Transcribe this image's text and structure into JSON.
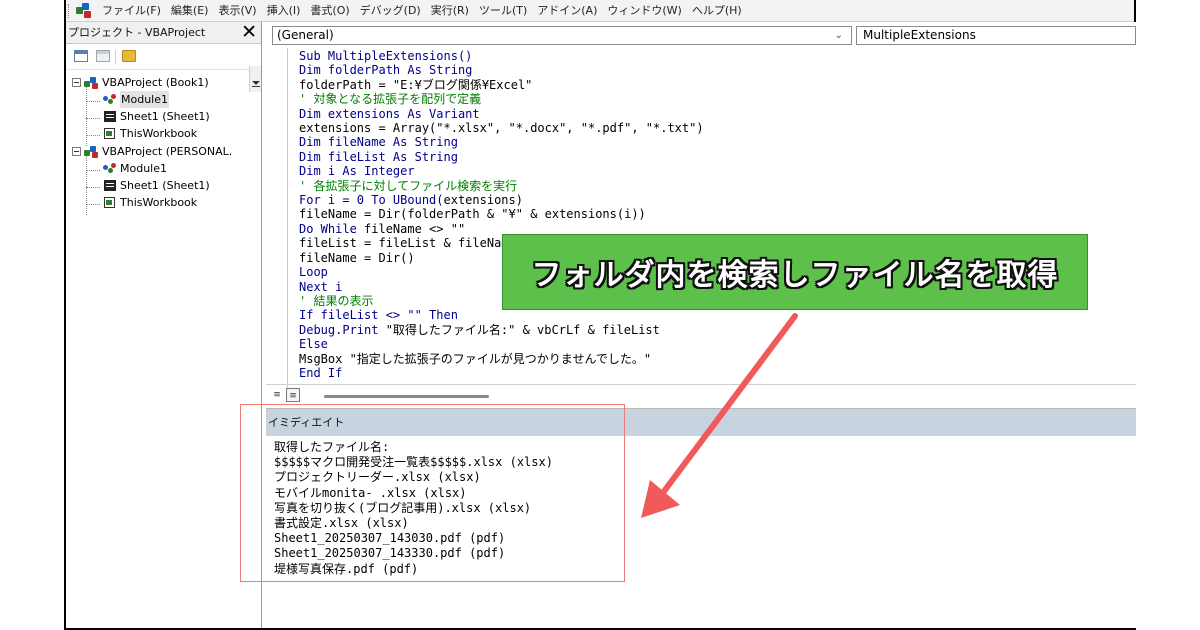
{
  "colors": {
    "callout_bg": "#5cc04a",
    "arrow": "#f05a5a",
    "keyword": "#00008b",
    "comment": "#008000",
    "highlight_box": "#f07a7a",
    "immediate_header": "#c8d3e0"
  },
  "menubar": {
    "items": [
      "ファイル(F)",
      "編集(E)",
      "表示(V)",
      "挿入(I)",
      "書式(O)",
      "デバッグ(D)",
      "実行(R)",
      "ツール(T)",
      "アドイン(A)",
      "ウィンドウ(W)",
      "ヘルプ(H)"
    ]
  },
  "project_explorer": {
    "title": "プロジェクト - VBAProject",
    "close_glyph": "✕",
    "tree": [
      {
        "label": "VBAProject (Book1)",
        "icon": "vbaproject-icon"
      },
      {
        "label": "Module1",
        "icon": "module-icon"
      },
      {
        "label": "Sheet1 (Sheet1)",
        "icon": "sheet-icon"
      },
      {
        "label": "ThisWorkbook",
        "icon": "workbook-icon"
      },
      {
        "label": "VBAProject (PERSONAL.",
        "icon": "vbaproject-icon"
      },
      {
        "label": "Module1",
        "icon": "module-icon"
      },
      {
        "label": "Sheet1 (Sheet1)",
        "icon": "sheet-icon"
      },
      {
        "label": "ThisWorkbook",
        "icon": "workbook-icon"
      }
    ]
  },
  "code_window": {
    "object_combo": "(General)",
    "procedure_combo": "MultipleExtensions",
    "lines": [
      [
        {
          "t": "Sub MultipleExtensions()",
          "c": "kw"
        }
      ],
      [
        {
          "t": "Dim folderPath As String",
          "c": "kw"
        }
      ],
      [
        {
          "t": "folderPath = \"E:¥ブログ関係¥Excel\"",
          "c": ""
        }
      ],
      [
        {
          "t": "' 対象となる拡張子を配列で定義",
          "c": "cm"
        }
      ],
      [
        {
          "t": "Dim extensions As Variant",
          "c": "kw"
        }
      ],
      [
        {
          "t": "extensions = Array(\"*.xlsx\", \"*.docx\", \"*.pdf\", \"*.txt\")",
          "c": ""
        }
      ],
      [
        {
          "t": "Dim fileName As String",
          "c": "kw"
        }
      ],
      [
        {
          "t": "Dim fileList As String",
          "c": "kw"
        }
      ],
      [
        {
          "t": "Dim i As Integer",
          "c": "kw"
        }
      ],
      [
        {
          "t": "' 各拡張子に対してファイル検索を実行",
          "c": "cm"
        }
      ],
      [
        {
          "t": "For i = 0 To UBound(",
          "c": "kw"
        },
        {
          "t": "extensions)",
          "c": ""
        }
      ],
      [
        {
          "t": "fileName = Dir(folderPath & \"¥\" & extensions(i))",
          "c": ""
        }
      ],
      [
        {
          "t": "Do While ",
          "c": "kw"
        },
        {
          "t": "fileName <> \"\"",
          "c": ""
        }
      ],
      [
        {
          "t": "fileList = fileList & fileNam",
          "c": ""
        }
      ],
      [
        {
          "t": "fileName = Dir()",
          "c": ""
        }
      ],
      [
        {
          "t": "Loop",
          "c": "kw"
        }
      ],
      [
        {
          "t": "Next i",
          "c": "kw"
        }
      ],
      [
        {
          "t": "' 結果の表示",
          "c": "cm"
        }
      ],
      [
        {
          "t": "If fileList <> \"\" Then",
          "c": "kw"
        }
      ],
      [
        {
          "t": "Debug.Print ",
          "c": "kw"
        },
        {
          "t": "\"取得したファイル名:\" & vbCrLf & fileList",
          "c": ""
        }
      ],
      [
        {
          "t": "Else",
          "c": "kw"
        }
      ],
      [
        {
          "t": "MsgBox \"指定した拡張子のファイルが見つかりませんでした。\"",
          "c": ""
        }
      ],
      [
        {
          "t": "End If",
          "c": "kw"
        }
      ]
    ]
  },
  "immediate_window": {
    "title": "イミディエイト",
    "output": [
      "取得したファイル名:",
      "$$$$$マクロ開発受注一覧表$$$$$.xlsx (xlsx)",
      "プロジェクトリーダー.xlsx (xlsx)",
      "モバイルmonita- .xlsx (xlsx)",
      "写真を切り抜く(ブログ記事用).xlsx (xlsx)",
      "書式設定.xlsx (xlsx)",
      "Sheet1_20250307_143030.pdf (pdf)",
      "Sheet1_20250307_143330.pdf (pdf)",
      "堤様写真保存.pdf (pdf)"
    ]
  },
  "callout": {
    "text": "フォルダ内を検索しファイル名を取得"
  }
}
